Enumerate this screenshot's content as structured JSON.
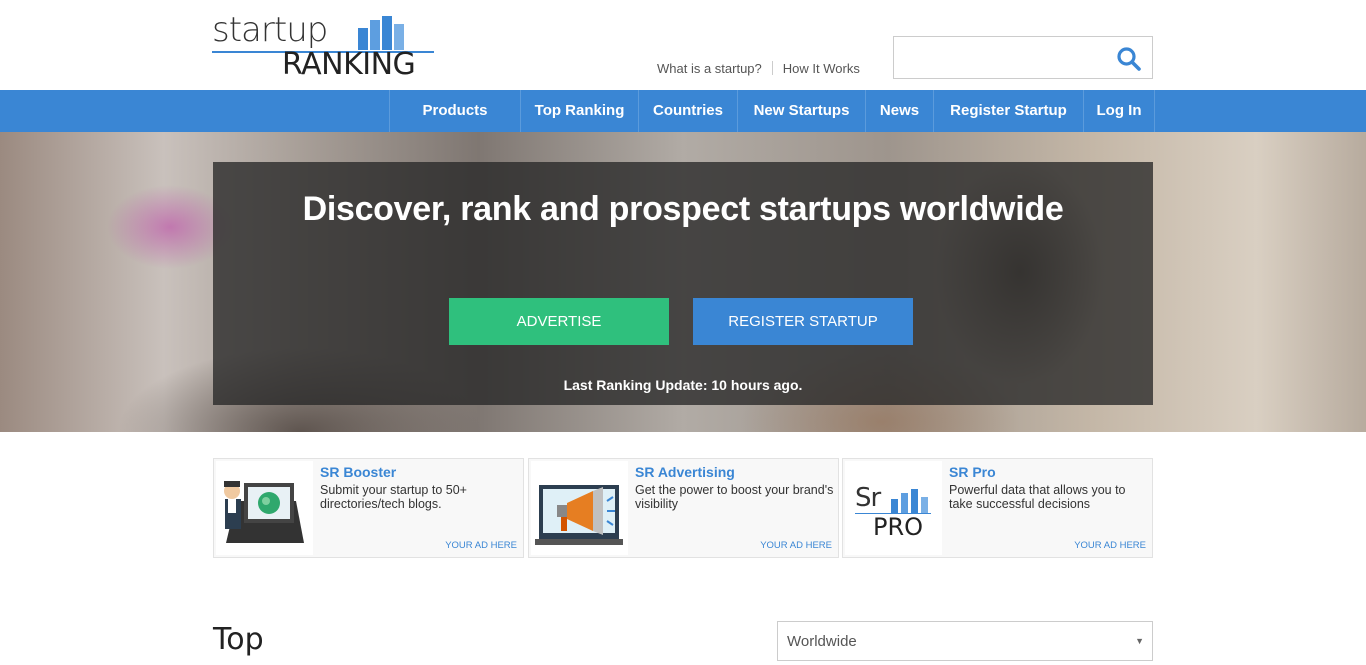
{
  "brand": {
    "logo_top": "startup",
    "logo_bottom": "RANKING"
  },
  "top_links": [
    {
      "label": "What is a startup?"
    },
    {
      "label": "How It Works"
    }
  ],
  "search": {
    "value": "",
    "placeholder": "",
    "icon": "search-icon"
  },
  "nav": {
    "items": [
      {
        "label": "Products"
      },
      {
        "label": "Top Ranking"
      },
      {
        "label": "Countries"
      },
      {
        "label": "New Startups"
      },
      {
        "label": "News"
      },
      {
        "label": "Register Startup"
      },
      {
        "label": "Log In"
      }
    ]
  },
  "hero": {
    "title": "Discover, rank and prospect startups worldwide",
    "advertise_label": "ADVERTISE",
    "register_label": "REGISTER STARTUP",
    "last_update_prefix": "Last Ranking Update: ",
    "last_update_value": "10 hours ago."
  },
  "ads": [
    {
      "title": "SR Booster",
      "desc": "Submit your startup to 50+ directories/tech blogs.",
      "cta": "YOUR AD HERE"
    },
    {
      "title": "SR Advertising",
      "desc": "Get the power to boost your brand's visibility",
      "cta": "YOUR AD HERE"
    },
    {
      "title": "SR Pro",
      "desc": "Powerful data that allows you to take successful decisions",
      "cta": "YOUR AD HERE",
      "logo_top": "Sr",
      "logo_bottom": "PRO"
    }
  ],
  "section": {
    "heading": "Top"
  },
  "region_select": {
    "value": "Worldwide"
  },
  "colors": {
    "brand_blue": "#3a86d4",
    "green": "#2fc07d"
  }
}
